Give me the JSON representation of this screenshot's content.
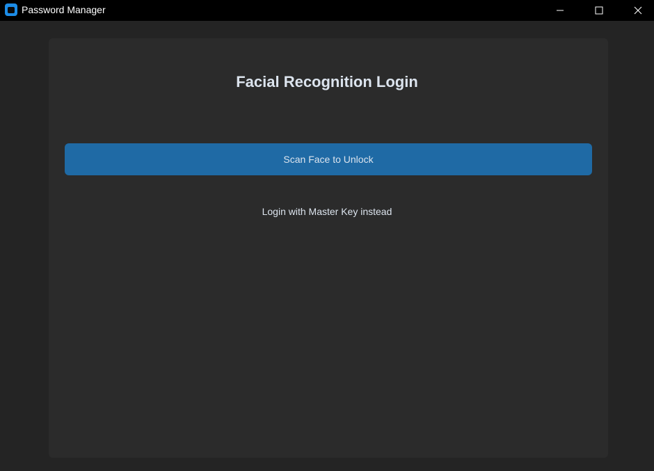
{
  "window": {
    "title": "Password Manager",
    "icon": "app-icon",
    "controls": {
      "minimize_icon": "minimize-icon",
      "maximize_icon": "maximize-icon",
      "close_icon": "close-icon"
    }
  },
  "login": {
    "heading": "Facial Recognition Login",
    "scan_button_label": "Scan Face to Unlock",
    "master_key_link_label": "Login with Master Key instead"
  },
  "colors": {
    "background": "#242424",
    "card": "#2b2b2b",
    "accent": "#1f6aa5",
    "text": "#dce4ee",
    "titlebar": "#000000"
  }
}
